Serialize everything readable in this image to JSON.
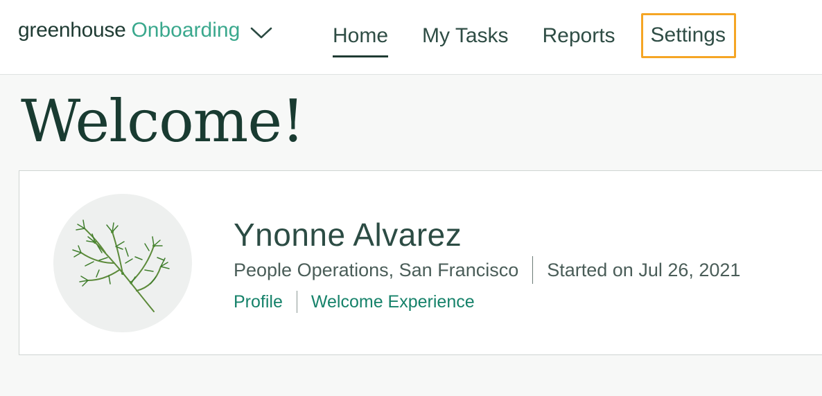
{
  "header": {
    "brand": {
      "wordmark": "greenhouse",
      "product": "Onboarding",
      "icon": "chevron-down-icon"
    },
    "nav": [
      {
        "label": "Home",
        "active": true
      },
      {
        "label": "My Tasks",
        "active": false
      },
      {
        "label": "Reports",
        "active": false
      },
      {
        "label": "Settings",
        "active": false,
        "highlighted": true
      }
    ]
  },
  "main": {
    "title": "Welcome!",
    "profile_card": {
      "avatar_icon": "dill-herb-illustration",
      "name": "Ynonne Alvarez",
      "department_location": "People Operations, San Francisco",
      "start_date": "Started on Jul 26, 2021",
      "links": [
        {
          "label": "Profile"
        },
        {
          "label": "Welcome Experience"
        }
      ]
    }
  },
  "colors": {
    "brand_dark": "#1f3b33",
    "brand_green": "#3aa88d",
    "link_green": "#16826a",
    "highlight_orange": "#f5a524",
    "page_bg": "#f7f8f7"
  }
}
